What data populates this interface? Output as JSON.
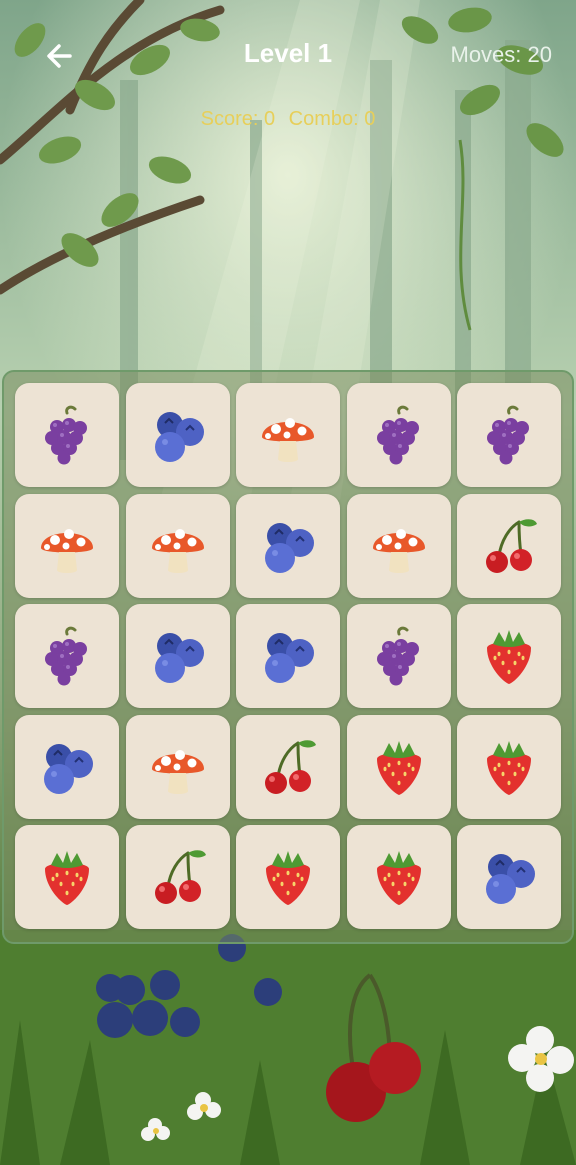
{
  "header": {
    "title": "Level 1",
    "moves": "Moves: 20",
    "score": "Score: 0",
    "combo": "Combo: 0"
  },
  "colors": {
    "tile_bg": "#ede3d4",
    "score_text": "#e7cf5a",
    "board_border": "#6f9a6a"
  },
  "board": {
    "rows": 5,
    "cols": 5,
    "tiles": [
      [
        "grapes",
        "blueberries",
        "mushroom",
        "grapes",
        "grapes"
      ],
      [
        "mushroom",
        "mushroom",
        "blueberries",
        "mushroom",
        "cherries"
      ],
      [
        "grapes",
        "blueberries",
        "blueberries",
        "grapes",
        "strawberry"
      ],
      [
        "blueberries",
        "mushroom",
        "cherries",
        "strawberry",
        "strawberry"
      ],
      [
        "strawberry",
        "cherries",
        "strawberry",
        "strawberry",
        "blueberries"
      ]
    ]
  }
}
